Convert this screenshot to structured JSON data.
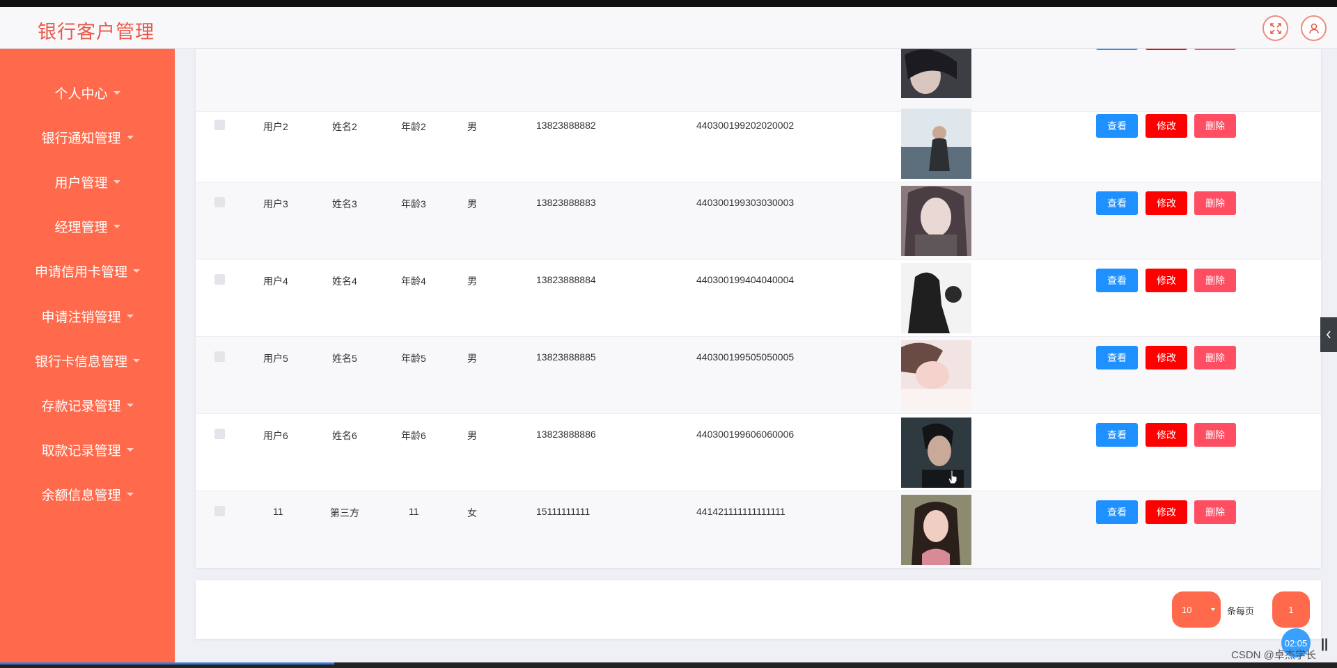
{
  "app": {
    "title": "银行客户管理"
  },
  "sidebar": {
    "items": [
      {
        "label": "个人中心"
      },
      {
        "label": "银行通知管理"
      },
      {
        "label": "用户管理"
      },
      {
        "label": "经理管理"
      },
      {
        "label": "申请信用卡管理"
      },
      {
        "label": "申请注销管理"
      },
      {
        "label": "银行卡信息管理"
      },
      {
        "label": "存款记录管理"
      },
      {
        "label": "取款记录管理"
      },
      {
        "label": "余额信息管理"
      }
    ]
  },
  "table": {
    "actions": {
      "view": "查看",
      "edit": "修改",
      "delete": "删除"
    },
    "rows": [
      {
        "account": "",
        "name": "",
        "age": "",
        "gender": "",
        "phone": "",
        "id_number": ""
      },
      {
        "account": "用户2",
        "name": "姓名2",
        "age": "年龄2",
        "gender": "男",
        "phone": "13823888882",
        "id_number": "440300199202020002"
      },
      {
        "account": "用户3",
        "name": "姓名3",
        "age": "年龄3",
        "gender": "男",
        "phone": "13823888883",
        "id_number": "440300199303030003"
      },
      {
        "account": "用户4",
        "name": "姓名4",
        "age": "年龄4",
        "gender": "男",
        "phone": "13823888884",
        "id_number": "440300199404040004"
      },
      {
        "account": "用户5",
        "name": "姓名5",
        "age": "年龄5",
        "gender": "男",
        "phone": "13823888885",
        "id_number": "440300199505050005"
      },
      {
        "account": "用户6",
        "name": "姓名6",
        "age": "年龄6",
        "gender": "男",
        "phone": "13823888886",
        "id_number": "440300199606060006"
      },
      {
        "account": "11",
        "name": "第三方",
        "age": "11",
        "gender": "女",
        "phone": "15111111111",
        "id_number": "441421111111111111"
      }
    ]
  },
  "pagination": {
    "page_size": "10",
    "per_page_label": "条每页",
    "current_page": "1"
  },
  "overlay": {
    "timer": "02:05",
    "watermark": "CSDN @卓杰学长"
  },
  "colors": {
    "accent": "#ff6a4c",
    "title": "#e8594a",
    "view_btn": "#1e90ff",
    "edit_btn": "#ff0000",
    "delete_btn": "#ff4d62"
  },
  "icons": {
    "fullscreen": "fullscreen-icon",
    "user": "user-icon",
    "collapse": "chevron-left-icon"
  }
}
